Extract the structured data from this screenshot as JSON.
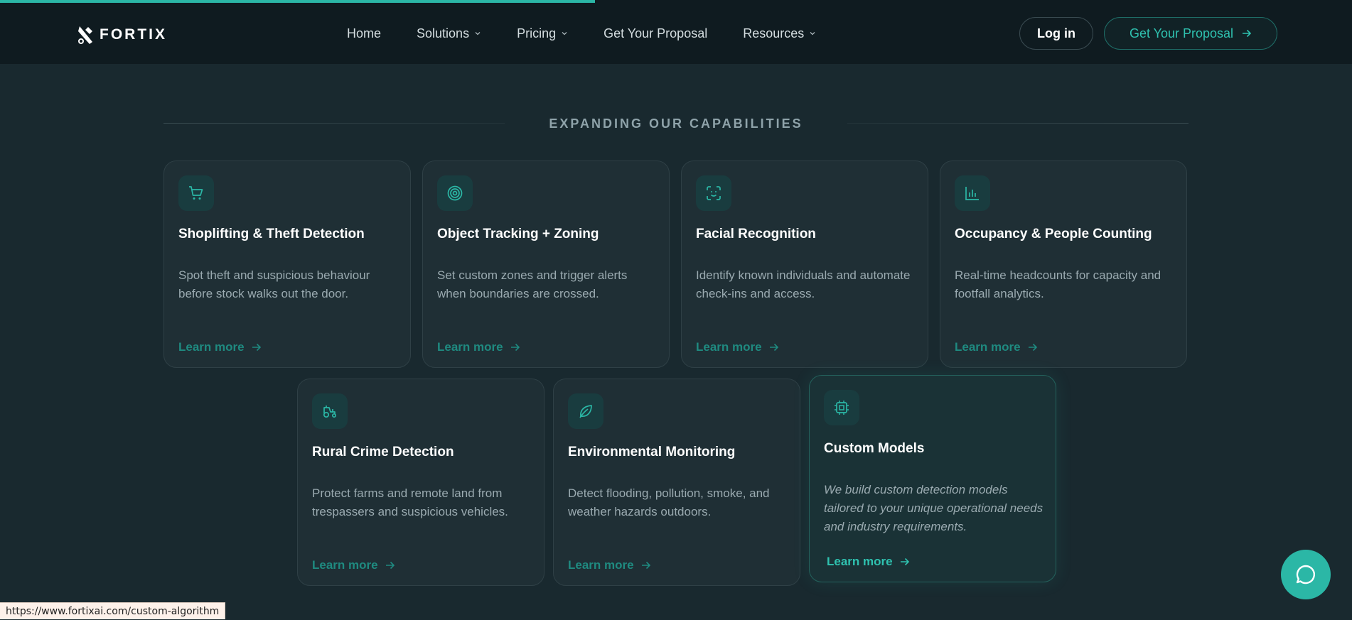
{
  "header": {
    "logo_text": "FORTIX",
    "nav": [
      {
        "label": "Home",
        "has_dropdown": false
      },
      {
        "label": "Solutions",
        "has_dropdown": true
      },
      {
        "label": "Pricing",
        "has_dropdown": true
      },
      {
        "label": "Get Your Proposal",
        "has_dropdown": false
      },
      {
        "label": "Resources",
        "has_dropdown": true
      }
    ],
    "login_label": "Log in",
    "cta_label": "Get Your Proposal"
  },
  "page_progress": 0.44,
  "section": {
    "title": "EXPANDING OUR CAPABILITIES"
  },
  "cards": [
    {
      "icon": "cart-icon",
      "title": "Shoplifting & Theft Detection",
      "description": "Spot theft and suspicious behaviour before stock walks out the door.",
      "link": "Learn more"
    },
    {
      "icon": "target-icon",
      "title": "Object Tracking + Zoning",
      "description": "Set custom zones and trigger alerts when boundaries are crossed.",
      "link": "Learn more"
    },
    {
      "icon": "face-scan-icon",
      "title": "Facial Recognition",
      "description": "Identify known individuals and automate check-ins and access.",
      "link": "Learn more"
    },
    {
      "icon": "bar-chart-icon",
      "title": "Occupancy & People Counting",
      "description": "Real-time headcounts for capacity and footfall analytics.",
      "link": "Learn more"
    },
    {
      "icon": "tractor-icon",
      "title": "Rural Crime Detection",
      "description": "Protect farms and remote land from trespassers and suspicious vehicles.",
      "link": "Learn more"
    },
    {
      "icon": "leaf-icon",
      "title": "Environmental Monitoring",
      "description": "Detect flooding, pollution, smoke, and weather hazards outdoors.",
      "link": "Learn more"
    },
    {
      "icon": "cpu-chip-icon",
      "title": "Custom Models",
      "description": "We build custom detection models tailored to your unique operational needs and industry requirements.",
      "link": "Learn more"
    }
  ],
  "status_bar": {
    "url": "https://www.fortixai.com/custom-algorithm"
  },
  "colors": {
    "accent": "#2bb7a6",
    "background": "#19292f",
    "header": "#0f1b20",
    "card": "#1f2f35"
  }
}
